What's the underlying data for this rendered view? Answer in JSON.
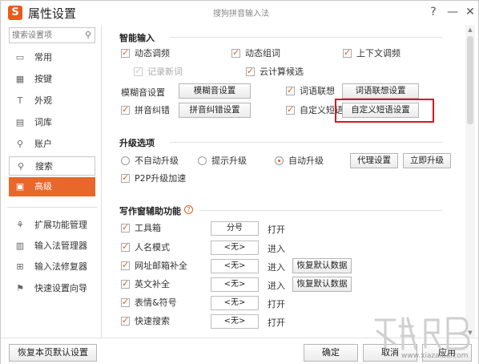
{
  "window": {
    "app_title": "属性设置",
    "caption": "搜狗拼音输入法",
    "help": "?",
    "minimize": "—",
    "close": "✕",
    "logo_glyph": "S",
    "accent_color": "#e8672a",
    "highlight_color": "#d9181e"
  },
  "sidebar": {
    "search_placeholder": "搜索设置项",
    "items": [
      {
        "label": "常用",
        "icon": "monitor-icon",
        "glyph": "▭"
      },
      {
        "label": "按键",
        "icon": "keyboard-icon",
        "glyph": "▦"
      },
      {
        "label": "外观",
        "icon": "shirt-icon",
        "glyph": "T"
      },
      {
        "label": "词库",
        "icon": "book-icon",
        "glyph": "▤"
      },
      {
        "label": "账户",
        "icon": "user-icon",
        "glyph": "⚲"
      },
      {
        "label": "搜索",
        "icon": "search-icon",
        "glyph": "⚲"
      },
      {
        "label": "高级",
        "icon": "advanced-icon",
        "glyph": "▣"
      }
    ],
    "tools": [
      {
        "label": "扩展功能管理",
        "icon": "extension-icon",
        "glyph": "⚘"
      },
      {
        "label": "输入法管理器",
        "icon": "manager-icon",
        "glyph": "▥"
      },
      {
        "label": "输入法修复器",
        "icon": "repair-icon",
        "glyph": "⊞"
      },
      {
        "label": "快速设置向导",
        "icon": "flag-icon",
        "glyph": "⚑"
      }
    ]
  },
  "smart_input": {
    "title": "智能输入",
    "dynamic_freq": "动态调频",
    "dynamic_phrase": "动态组词",
    "context_freq": "上下文调频",
    "record_new": "记录新词",
    "cloud": "云计算候选",
    "fuzzy_label": "模糊音设置",
    "fuzzy_button": "模糊音设置",
    "association": "词语联想",
    "association_button": "词语联想设置",
    "correction": "拼音纠错",
    "correction_button": "拼音纠错设置",
    "custom_phrase": "自定义短语",
    "custom_phrase_button": "自定义短语设置"
  },
  "upgrade": {
    "title": "升级选项",
    "no_auto": "不自动升级",
    "prompt": "提示升级",
    "auto": "自动升级",
    "proxy_button": "代理设置",
    "now_button": "立即升级",
    "p2p": "P2P升级加速"
  },
  "writing": {
    "title": "写作窗辅助功能",
    "help": "?",
    "open": "打开",
    "enter": "进入",
    "restore_button": "恢复默认数据",
    "rows": [
      {
        "label": "工具箱",
        "value": "分号"
      },
      {
        "label": "人名模式",
        "value": "<无>"
      },
      {
        "label": "网址邮箱补全",
        "value": "<无>"
      },
      {
        "label": "英文补全",
        "value": "<无>"
      },
      {
        "label": "表情&符号",
        "value": "<无>"
      },
      {
        "label": "快速搜索",
        "value": "<无>"
      }
    ]
  },
  "footer": {
    "restore": "恢复本页默认设置",
    "ok": "确定",
    "cancel": "取消",
    "apply": "应用"
  },
  "watermark": {
    "text": "www.xiazaiba.com"
  }
}
